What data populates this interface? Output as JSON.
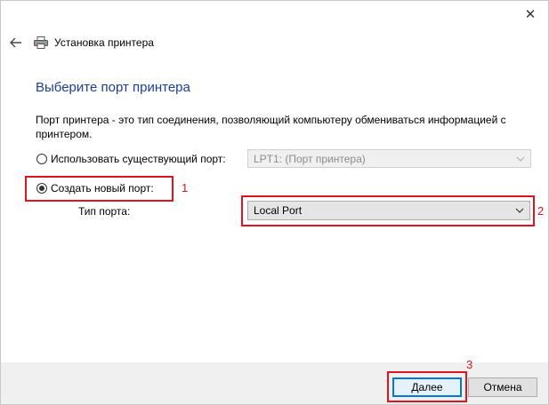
{
  "window": {
    "title": "Установка принтера",
    "close_glyph": "✕"
  },
  "page": {
    "heading": "Выберите порт принтера",
    "description": "Порт принтера - это тип соединения, позволяющий компьютеру обмениваться информацией с принтером."
  },
  "options": {
    "use_existing": {
      "label": "Использовать существующий порт:",
      "selected": false,
      "value": "LPT1: (Порт принтера)"
    },
    "create_new": {
      "label": "Создать новый порт:",
      "selected": true
    },
    "port_type": {
      "label": "Тип порта:",
      "value": "Local Port"
    }
  },
  "annotations": {
    "one": "1",
    "two": "2",
    "three": "3",
    "color": "#e0141e"
  },
  "buttons": {
    "next": "Далее",
    "cancel": "Отмена"
  },
  "colors": {
    "heading": "#1a3e97",
    "accent": "#0078d7"
  },
  "icons": {
    "back": "arrow-left-icon",
    "printer": "printer-icon",
    "close": "close-icon",
    "dropdown": "chevron-down-icon"
  }
}
